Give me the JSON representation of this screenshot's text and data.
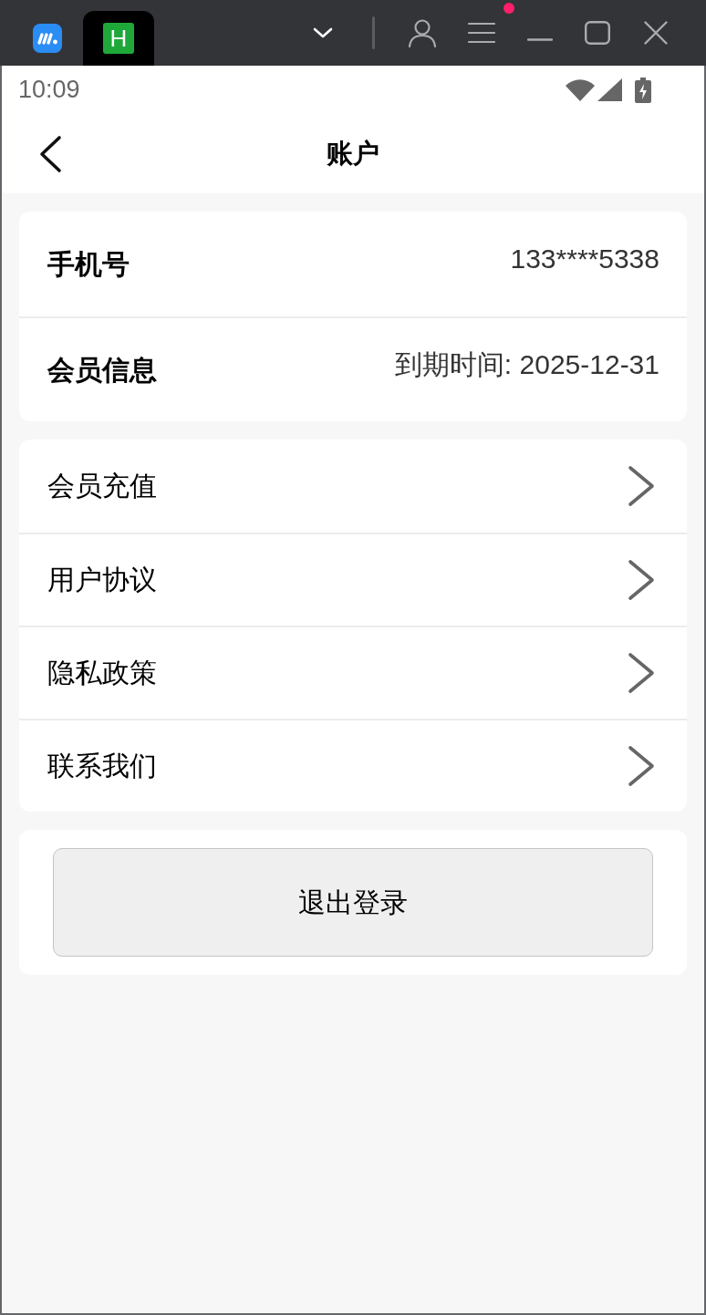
{
  "browser_bar": {
    "tabs": [
      {
        "kind": "app",
        "selected": false
      },
      {
        "kind": "letter",
        "label": "H",
        "selected": true
      }
    ],
    "menu_notification": true
  },
  "status_bar": {
    "time": "10:09"
  },
  "header": {
    "title": "账户"
  },
  "info_card": {
    "rows": [
      {
        "label": "手机号",
        "value": "133****5338"
      },
      {
        "label": "会员信息",
        "value": "到期时间: 2025-12-31"
      }
    ]
  },
  "menu": {
    "items": [
      {
        "label": "会员充值"
      },
      {
        "label": "用户协议"
      },
      {
        "label": "隐私政策"
      },
      {
        "label": "联系我们"
      }
    ]
  },
  "logout_button": {
    "label": "退出登录"
  }
}
